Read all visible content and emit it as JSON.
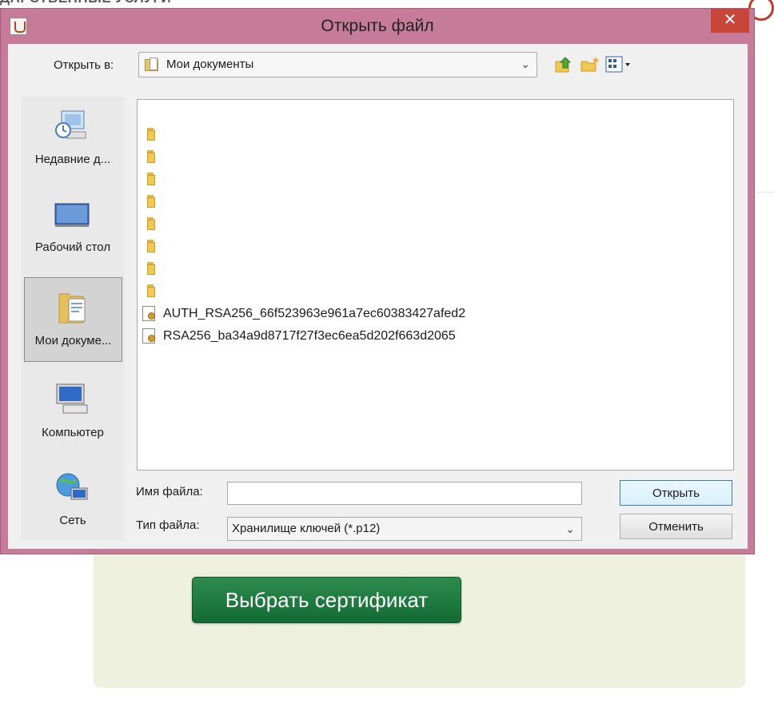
{
  "background": {
    "header_text": "ДАРСТВЕННЫЕ УСЛУГИ",
    "choose_certificate_button": "Выбрать сертификат"
  },
  "dialog": {
    "title": "Открыть файл",
    "close_glyph": "✕",
    "lookin_label": "Открыть в:",
    "lookin_value": "Мои документы",
    "places": [
      {
        "label": "Недавние д...",
        "icon": "recent-documents-icon"
      },
      {
        "label": "Рабочий стол",
        "icon": "desktop-icon"
      },
      {
        "label": "Мои докуме...",
        "icon": "my-documents-icon",
        "selected": true
      },
      {
        "label": "Компьютер",
        "icon": "computer-icon"
      },
      {
        "label": "Сеть",
        "icon": "network-icon"
      }
    ],
    "files": [
      {
        "type": "folder",
        "name": ""
      },
      {
        "type": "folder",
        "name": ""
      },
      {
        "type": "folder",
        "name": ""
      },
      {
        "type": "folder",
        "name": ""
      },
      {
        "type": "folder",
        "name": ""
      },
      {
        "type": "folder",
        "name": ""
      },
      {
        "type": "folder",
        "name": ""
      },
      {
        "type": "folder",
        "name": ""
      },
      {
        "type": "keystore",
        "name": "AUTH_RSA256_66f523963e961a7ec60383427afed2"
      },
      {
        "type": "keystore",
        "name": "RSA256_ba34a9d8717f27f3ec6ea5d202f663d2065"
      }
    ],
    "filename_label": "Имя файла:",
    "filename_value": "",
    "filetype_label": "Тип файла:",
    "filetype_value": "Хранилище ключей (*.p12)",
    "open_button": "Открыть",
    "cancel_button": "Отменить"
  }
}
